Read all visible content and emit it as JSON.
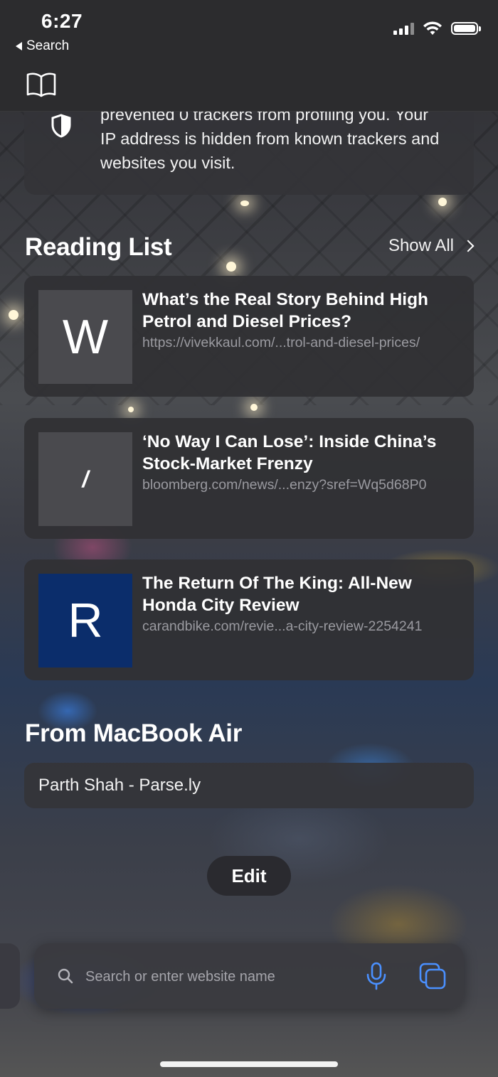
{
  "status_bar": {
    "time": "6:27",
    "back_label": "Search"
  },
  "privacy": {
    "text": "prevented 0 trackers from profiling you. Your IP address is hidden from known trackers and websites you visit."
  },
  "reading_list": {
    "title": "Reading List",
    "show_all": "Show All",
    "items": [
      {
        "thumb_letter": "W",
        "thumb_color": "#4a4a4e",
        "title": "What’s the Real Story Behind High Petrol and Diesel Prices?",
        "url": "https://vivekkaul.com/...trol-and-diesel-prices/"
      },
      {
        "thumb_letter": "/",
        "thumb_color": "#4a4a4e",
        "title": "‘No Way I Can Lose’: Inside China’s Stock-Market Frenzy",
        "url": "bloomberg.com/news/...enzy?sref=Wq5d68P0"
      },
      {
        "thumb_letter": "R",
        "thumb_color": "#0b2d6b",
        "title": "The Return Of The King: All-New Honda City Review",
        "url": "carandbike.com/revie...a-city-review-2254241"
      }
    ]
  },
  "devices": {
    "title": "From MacBook Air",
    "tabs": [
      {
        "label": "Parth Shah - Parse.ly"
      }
    ]
  },
  "edit_label": "Edit",
  "address_bar": {
    "placeholder": "Search or enter website name",
    "accent_color": "#4a90ff"
  },
  "icons": [
    "back-arrow-icon",
    "signal-icon",
    "wifi-icon",
    "battery-icon",
    "book-icon",
    "shield-icon",
    "chevron-right-icon",
    "search-icon",
    "microphone-icon",
    "tabs-icon"
  ]
}
